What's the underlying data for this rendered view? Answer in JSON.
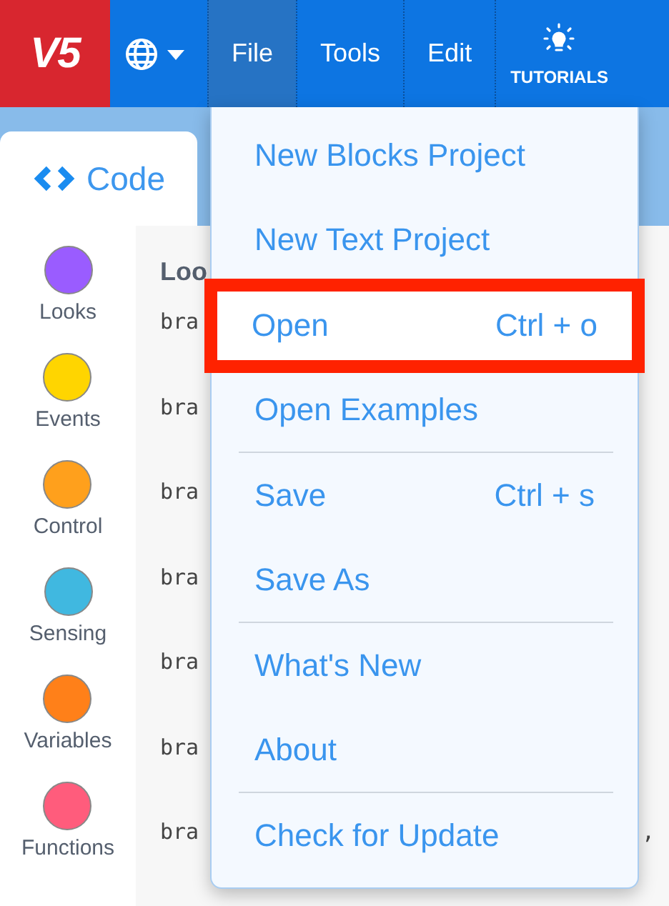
{
  "header": {
    "logo": "V5",
    "menus": [
      {
        "label": "File",
        "selected": true
      },
      {
        "label": "Tools",
        "selected": false
      },
      {
        "label": "Edit",
        "selected": false
      }
    ],
    "tutorials": "TUTORIALS"
  },
  "code_tab": {
    "label": "Code"
  },
  "categories": [
    {
      "label": "Looks",
      "color": "#9a5cff"
    },
    {
      "label": "Events",
      "color": "#ffd500"
    },
    {
      "label": "Control",
      "color": "#ffa01c"
    },
    {
      "label": "Sensing",
      "color": "#40b8e0"
    },
    {
      "label": "Variables",
      "color": "#ff8019"
    },
    {
      "label": "Functions",
      "color": "#ff5c7c"
    }
  ],
  "code": {
    "heading": "Loo",
    "lines": [
      "bra",
      "bra",
      "bra",
      "bra",
      "bra",
      "bra",
      "bra"
    ],
    "trailing": ","
  },
  "file_menu": [
    {
      "kind": "item",
      "label": "New Blocks Project",
      "highlighted": false
    },
    {
      "kind": "item",
      "label": "New Text Project",
      "highlighted": false
    },
    {
      "kind": "item",
      "label": "Open",
      "shortcut": "Ctrl + o",
      "highlighted": true
    },
    {
      "kind": "item",
      "label": "Open Examples",
      "highlighted": false
    },
    {
      "kind": "separator"
    },
    {
      "kind": "item",
      "label": "Save",
      "shortcut": "Ctrl + s",
      "highlighted": false
    },
    {
      "kind": "item",
      "label": "Save As",
      "highlighted": false
    },
    {
      "kind": "separator"
    },
    {
      "kind": "item",
      "label": "What's New",
      "highlighted": false
    },
    {
      "kind": "item",
      "label": "About",
      "highlighted": false
    },
    {
      "kind": "separator"
    },
    {
      "kind": "item",
      "label": "Check for Update",
      "highlighted": false
    }
  ]
}
